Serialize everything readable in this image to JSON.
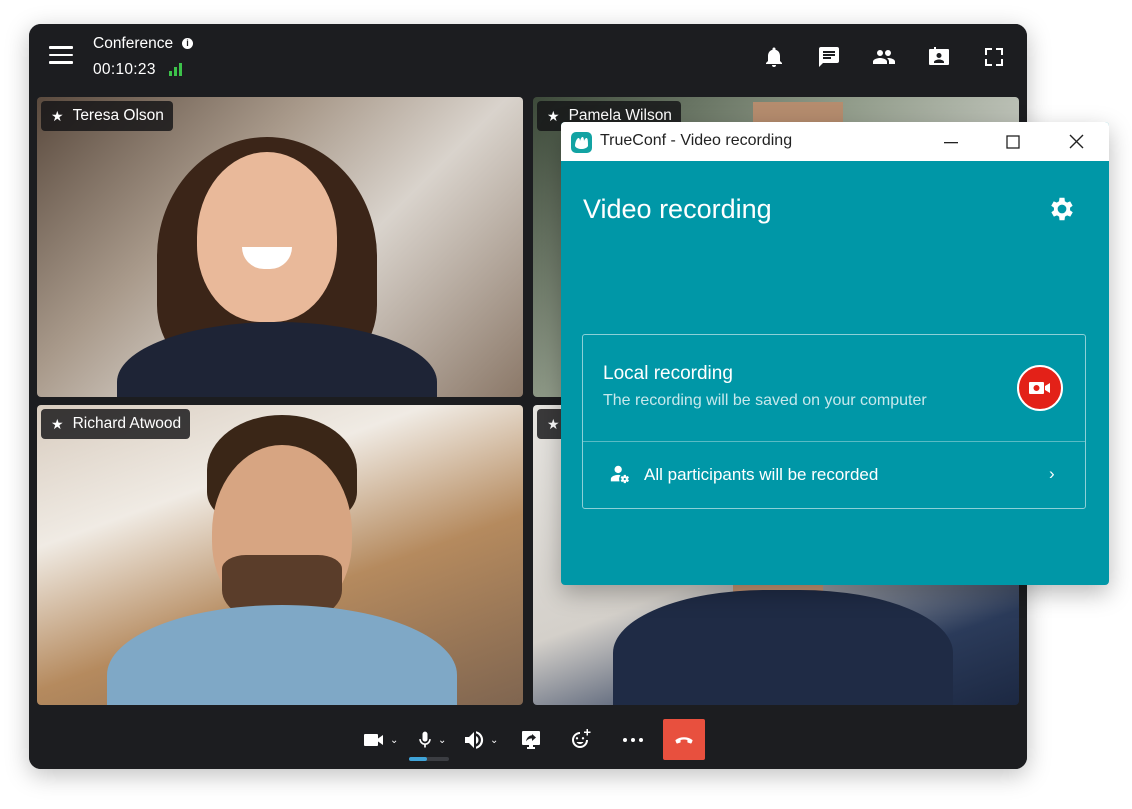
{
  "conference": {
    "title": "Conference",
    "timer": "00:10:23",
    "icons": [
      "info-icon",
      "signal-strength-icon",
      "bell-icon",
      "chat-icon",
      "participants-icon",
      "content-share-icon",
      "fullscreen-icon"
    ]
  },
  "participants": [
    {
      "name": "Teresa Olson"
    },
    {
      "name": "Pamela Wilson"
    },
    {
      "name": "Richard Atwood"
    },
    {
      "name": ""
    }
  ],
  "controls": {
    "icons": [
      "camera-icon",
      "microphone-icon",
      "speaker-icon",
      "screen-share-icon",
      "add-reaction-icon",
      "more-icon",
      "end-call-icon"
    ],
    "mic_level": 0.45,
    "end_call_color": "#e8503e"
  },
  "recording_window": {
    "title": "TrueConf - Video recording",
    "heading": "Video recording",
    "local_recording": {
      "title": "Local recording",
      "subtitle": "The recording will be saved on your computer"
    },
    "participants_option": "All participants will be recorded",
    "accent_color": "#0097a7",
    "record_button_color": "#e32118"
  }
}
